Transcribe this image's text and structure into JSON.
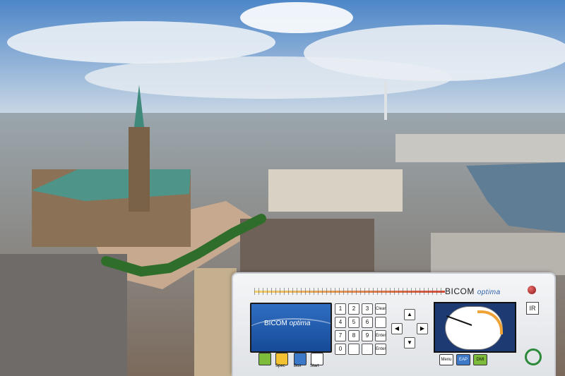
{
  "photo": {
    "subject": "Aerial view of Hamburg city centre with Rathaus, Binnenalster and Heinrich-Hertz-Turm",
    "sky_color": "#5f93cf",
    "cloud_color": "#f2f4f7",
    "lake_color": "#5f7e95",
    "roof_green": "#4f9488"
  },
  "device": {
    "brand": "BICOM",
    "brand_sub": "optima",
    "screen_brand": "BICOM",
    "screen_sub": "optima",
    "ir_label": "IR",
    "keypad": [
      "1",
      "2",
      "3",
      "Clear",
      "4",
      "5",
      "6",
      "",
      "7",
      "8",
      "9",
      "Enter",
      "0",
      "",
      "",
      "Enter"
    ],
    "arrow_keys": [
      "▲",
      "◀",
      "▶",
      "▼"
    ],
    "function_buttons": [
      {
        "label": "",
        "color": "#7dbb3a"
      },
      {
        "label": "Spec",
        "color": "#f2c233"
      },
      {
        "label": "Box",
        "color": "#3b78c8"
      },
      {
        "label": "Start",
        "color": "#ffffff"
      }
    ],
    "mode_buttons": [
      "Menu",
      "EAP",
      "DMI"
    ]
  }
}
